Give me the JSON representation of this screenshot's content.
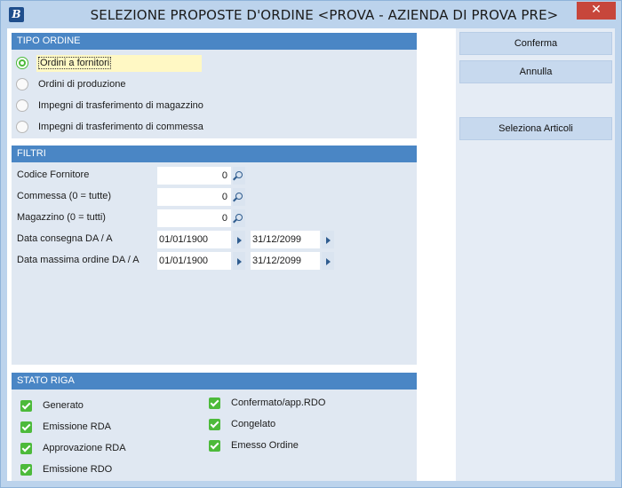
{
  "window": {
    "title": "SELEZIONE PROPOSTE D'ORDINE <PROVA - AZIENDA DI PROVA PRE>",
    "app_icon_letter": "B",
    "close_glyph": "✕"
  },
  "tipo_ordine": {
    "header": "TIPO ORDINE",
    "options": [
      {
        "label": "Ordini a fornitori",
        "selected": true
      },
      {
        "label": "Ordini di produzione",
        "selected": false
      },
      {
        "label": "Impegni di trasferimento di magazzino",
        "selected": false
      },
      {
        "label": "Impegni di trasferimento di commessa",
        "selected": false
      }
    ]
  },
  "filtri": {
    "header": "FILTRI",
    "codice_fornitore": {
      "label": "Codice Fornitore",
      "value": "0"
    },
    "commessa": {
      "label": "Commessa (0 = tutte)",
      "value": "0"
    },
    "magazzino": {
      "label": "Magazzino (0 = tutti)",
      "value": "0"
    },
    "data_consegna": {
      "label": "Data consegna DA / A",
      "from": "01/01/1900",
      "to": "31/12/2099"
    },
    "data_massima": {
      "label": "Data massima ordine DA / A",
      "from": "01/01/1900",
      "to": "31/12/2099"
    }
  },
  "stato_riga": {
    "header": "STATO RIGA",
    "left": [
      {
        "label": "Generato",
        "checked": true
      },
      {
        "label": "Emissione RDA",
        "checked": true
      },
      {
        "label": "Approvazione RDA",
        "checked": true
      },
      {
        "label": "Emissione RDO",
        "checked": true
      }
    ],
    "right": [
      {
        "label": "Confermato/app.RDO",
        "checked": true
      },
      {
        "label": "Congelato",
        "checked": true
      },
      {
        "label": "Emesso Ordine",
        "checked": true
      }
    ]
  },
  "actions": {
    "conferma": "Conferma",
    "annulla": "Annulla",
    "seleziona_articoli": "Seleziona Articoli"
  },
  "colors": {
    "accent": "#4a86c5",
    "check_green": "#4cba3a",
    "close_red": "#c7463b",
    "button_bg": "#c7d9ee"
  }
}
